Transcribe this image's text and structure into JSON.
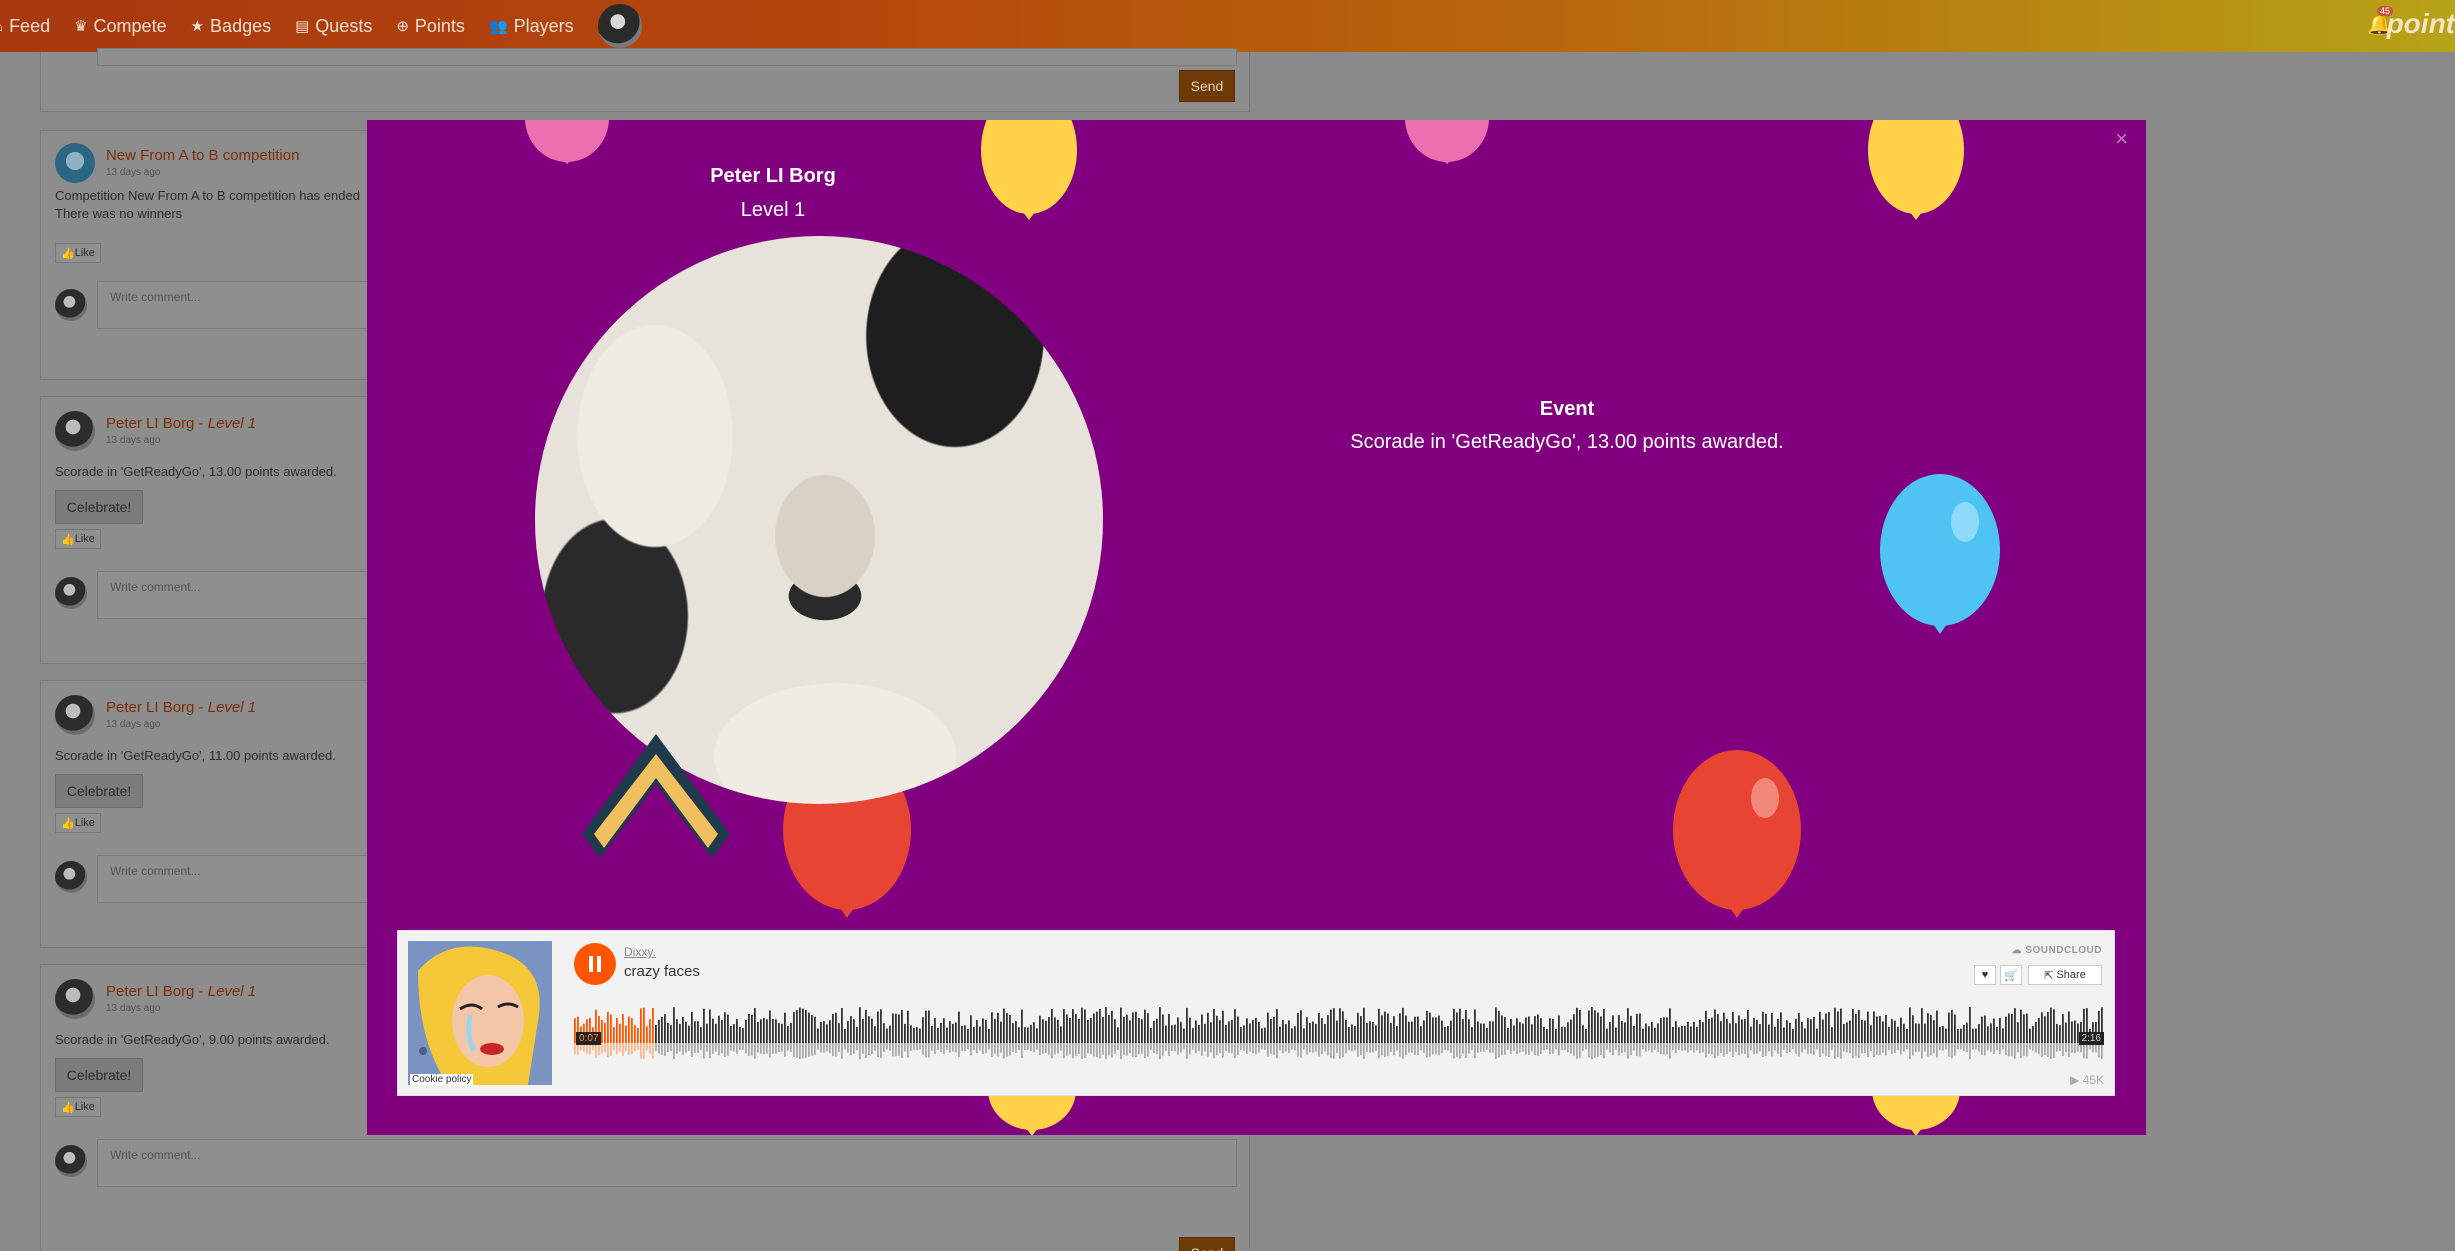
{
  "nav": {
    "items": [
      {
        "icon": "rss-icon",
        "glyph": "⌂",
        "label": "Feed"
      },
      {
        "icon": "trophy-icon",
        "glyph": "♛",
        "label": "Compete"
      },
      {
        "icon": "star-icon",
        "glyph": "★",
        "label": "Badges"
      },
      {
        "icon": "book-icon",
        "glyph": "▤",
        "label": "Quests"
      },
      {
        "icon": "plus-circle-icon",
        "glyph": "⊕",
        "label": "Points"
      },
      {
        "icon": "users-icon",
        "glyph": "👥",
        "label": "Players"
      }
    ],
    "notifications_count": "45",
    "brand": "point"
  },
  "feed": {
    "send_label": "Send",
    "comment_placeholder": "Write comment...",
    "like_label": "Like",
    "celebrate_label": "Celebrate!",
    "posts": [
      {
        "title": "New From A to B competition",
        "level": "",
        "time": "13 days ago",
        "body": "Competition New From A to B competition has ended",
        "body2": "There was no winners"
      },
      {
        "title": "Peter LI Borg",
        "level": "Level 1",
        "time": "13 days ago",
        "body": "Scorade in 'GetReadyGo', 13.00 points awarded.",
        "body2": ""
      },
      {
        "title": "Peter LI Borg",
        "level": "Level 1",
        "time": "13 days ago",
        "body": "Scorade in 'GetReadyGo', 11.00 points awarded.",
        "body2": ""
      },
      {
        "title": "Peter LI Borg",
        "level": "Level 1",
        "time": "13 days ago",
        "body": "Scorade in 'GetReadyGo', 9.00 points awarded.",
        "body2": ""
      }
    ]
  },
  "modal": {
    "close": "×",
    "user_name": "Peter LI Borg",
    "user_level": "Level 1",
    "event_title": "Event",
    "event_text": "Scorade in 'GetReadyGo', 13.00 points awarded.",
    "colors": {
      "background": "#800080",
      "pink": "#ec6fb0",
      "yellow": "#ffd24a",
      "blue": "#4fc3f2",
      "red": "#e84434",
      "chevron": "#f0c060"
    }
  },
  "player": {
    "artist": "Dixxy.",
    "track": "crazy faces",
    "brand": "SOUNDCLOUD",
    "share_label": "Share",
    "time_elapsed": "0:07",
    "time_total": "2:16",
    "plays": "45K",
    "cookie": "Cookie policy",
    "progress": 0.052,
    "accent": "#ff5500"
  }
}
